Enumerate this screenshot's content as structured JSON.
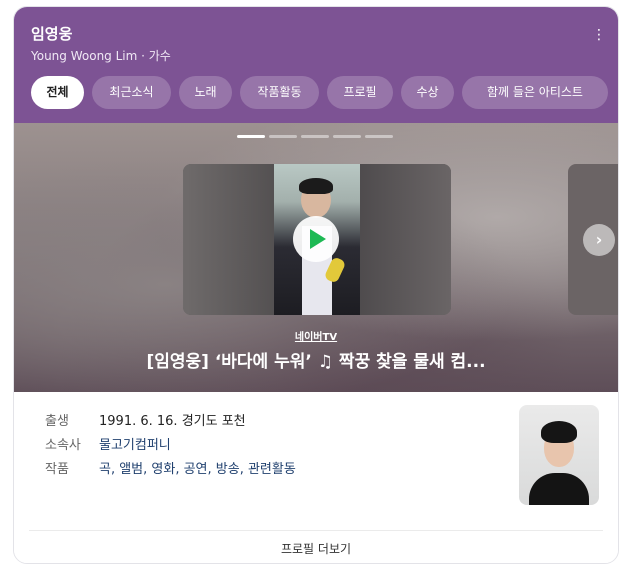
{
  "header": {
    "title": "임영웅",
    "subtitle": "Young Woong Lim · 가수",
    "menu_icon": "kebab-menu-icon"
  },
  "tabs": [
    {
      "label": "전체",
      "active": true
    },
    {
      "label": "최근소식",
      "active": false
    },
    {
      "label": "노래",
      "active": false
    },
    {
      "label": "작품활동",
      "active": false
    },
    {
      "label": "프로필",
      "active": false
    },
    {
      "label": "수상",
      "active": false
    },
    {
      "label": "함께 들은 아티스트",
      "active": false
    }
  ],
  "media": {
    "slides_total": 5,
    "active_slide": 1,
    "source": "네이버TV",
    "caption": "[임영웅] ‘바다에 누워’ ♫ 짝꿍 찾을 물새 컴...",
    "play_icon": "play-icon",
    "next_icon": "chevron-right-icon"
  },
  "profile": {
    "rows": [
      {
        "key": "출생",
        "value": "1991. 6. 16. 경기도 포천",
        "link": false
      },
      {
        "key": "소속사",
        "value": "물고기컴퍼니",
        "link": true
      },
      {
        "key": "작품",
        "value": "곡, 앨범, 영화, 공연, 방송, 관련활동",
        "link": true
      }
    ],
    "more_label": "프로필 더보기"
  },
  "colors": {
    "header_bg": "#7d5394",
    "link": "#21416f",
    "play_accent": "#1db954"
  }
}
